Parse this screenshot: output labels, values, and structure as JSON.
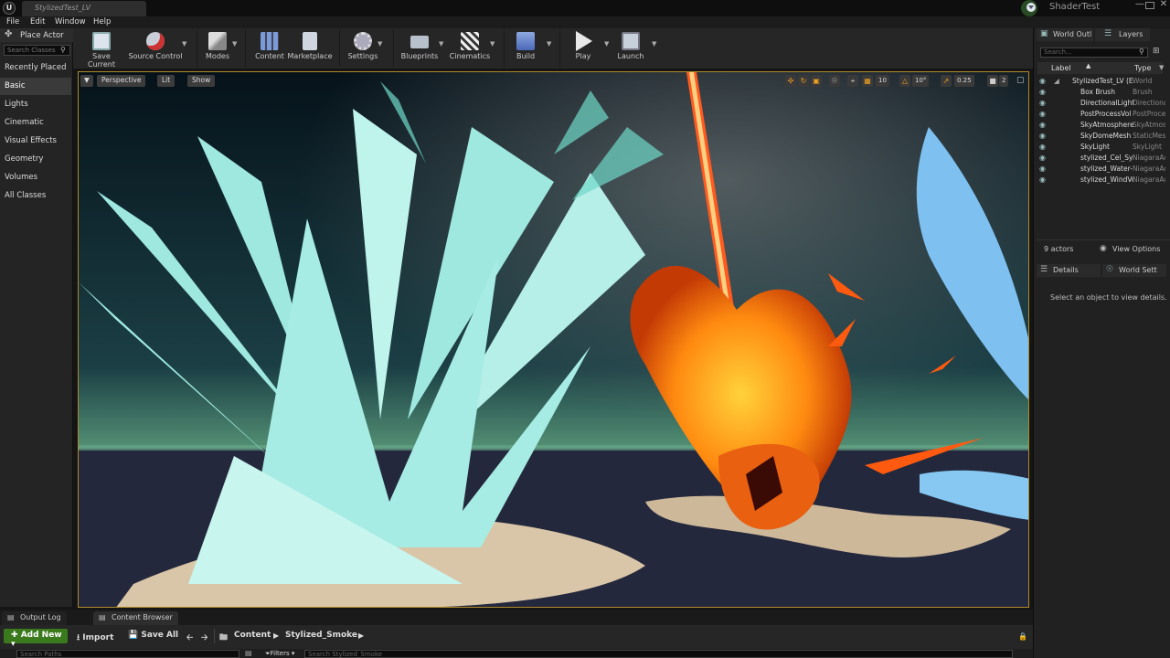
{
  "titlebar": {
    "level_tab": "StylizedTest_LV",
    "project": "ShaderTest",
    "ue_logo": "U"
  },
  "menu": [
    "File",
    "Edit",
    "Window",
    "Help"
  ],
  "place_actors": {
    "title": "Place Actor",
    "search_placeholder": "Search Classes",
    "categories": [
      "Recently Placed",
      "Basic",
      "Lights",
      "Cinematic",
      "Visual Effects",
      "Geometry",
      "Volumes",
      "All Classes"
    ],
    "selected": "Basic"
  },
  "toolbar": {
    "buttons": [
      "Save Current",
      "Source Control",
      "Modes",
      "Content",
      "Marketplace",
      "Settings",
      "Blueprints",
      "Cinematics",
      "Build",
      "Play",
      "Launch"
    ],
    "icons": [
      "save-icon",
      "source-control-icon",
      "modes-icon",
      "content-icon",
      "marketplace-icon",
      "settings-icon",
      "blueprints-icon",
      "cinematics-icon",
      "build-icon",
      "play-icon",
      "launch-icon"
    ]
  },
  "viewport": {
    "view_menu": "Perspective",
    "lighting": "Lit",
    "show": "Show",
    "grid_snap": "10",
    "rotation_snap": "10°",
    "scale_snap": "0.25",
    "camera_speed": "2"
  },
  "outliner": {
    "tab_outliner": "World Outl",
    "tab_layers": "Layers",
    "search_placeholder": "Search...",
    "col_label": "Label",
    "col_type": "Type",
    "rows": [
      {
        "label": "StylizedTest_LV (E",
        "type": "World"
      },
      {
        "label": "Box Brush",
        "type": "Brush"
      },
      {
        "label": "DirectionalLight",
        "type": "Directiona"
      },
      {
        "label": "PostProcessVol",
        "type": "PostProce"
      },
      {
        "label": "SkyAtmosphere",
        "type": "SkyAtmos"
      },
      {
        "label": "SkyDomeMesh",
        "type": "StaticMes"
      },
      {
        "label": "SkyLight",
        "type": "SkyLight"
      },
      {
        "label": "stylized_Cel_Sys",
        "type": "NiagaraAc"
      },
      {
        "label": "stylized_Water-",
        "type": "NiagaraAc"
      },
      {
        "label": "stylized_WindVo",
        "type": "NiagaraAc"
      }
    ],
    "actor_count": "9 actors",
    "view_options": "View Options"
  },
  "details": {
    "tab_details": "Details",
    "tab_world": "World Sett",
    "empty_message": "Select an object to view details."
  },
  "bottom": {
    "tab_output": "Output Log",
    "tab_content": "Content Browser",
    "add_new": "Add New",
    "import": "Import",
    "save_all": "Save All",
    "path_root": "Content",
    "path_folder": "Stylized_Smoke",
    "search_paths": "Search Paths",
    "filters": "Filters",
    "search_assets": "Search Stylized_Smoke"
  },
  "colors": {
    "accent": "#b08a2a",
    "add_new_green": "#3a7a1c",
    "water": "#9fe8e0",
    "fire": "#ff8a10",
    "beam": "#ff5a20"
  }
}
